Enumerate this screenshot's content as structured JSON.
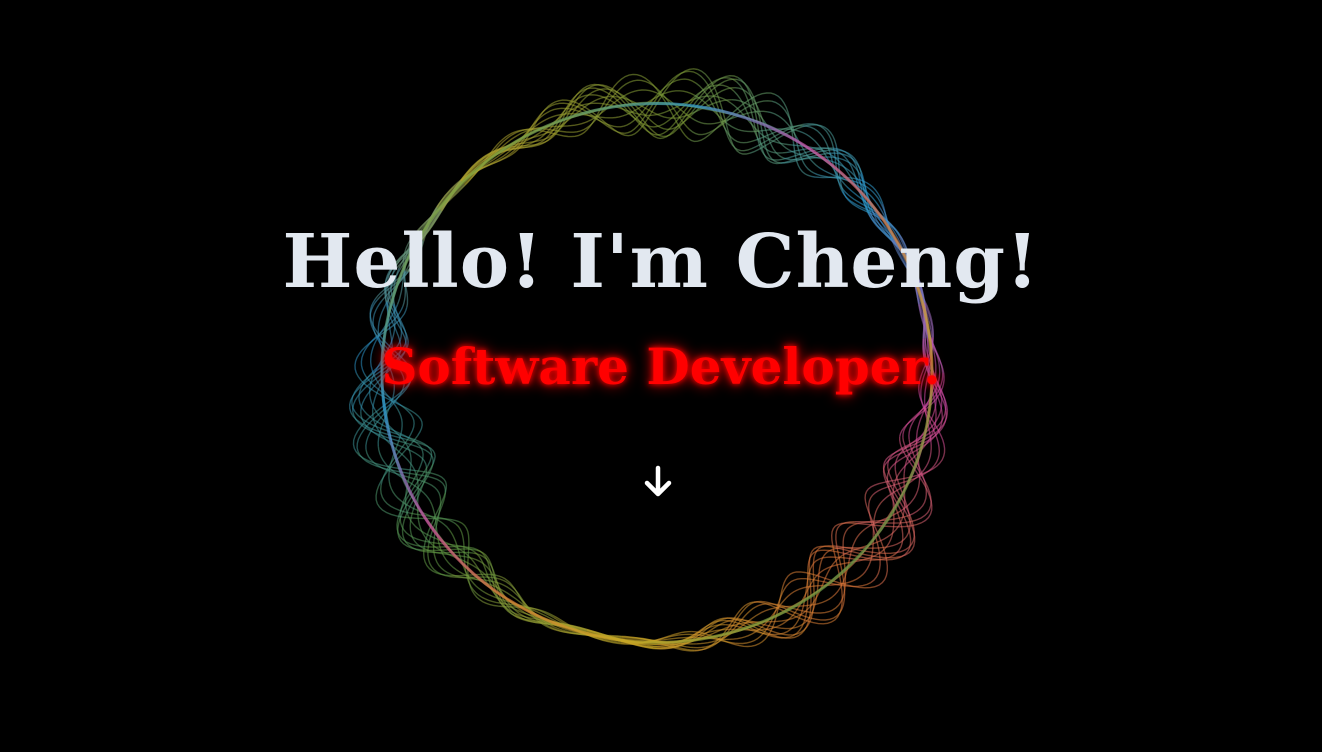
{
  "hero": {
    "greeting": "Hello! I'm Cheng!",
    "role": "Software Developer."
  },
  "scroll": {
    "icon": "arrow-down-icon"
  },
  "colors": {
    "background": "#000000",
    "greeting_text": "#e2e8f0",
    "role_text": "#ff0000",
    "role_glow": "#ff0000",
    "arrow": "#ffffff",
    "ring_palette": [
      "#b5a52c",
      "#7d9f3a",
      "#2f9dd6",
      "#d94aa8",
      "#e07a36",
      "#c9a825",
      "#5e9a46",
      "#2a8fc8"
    ]
  }
}
